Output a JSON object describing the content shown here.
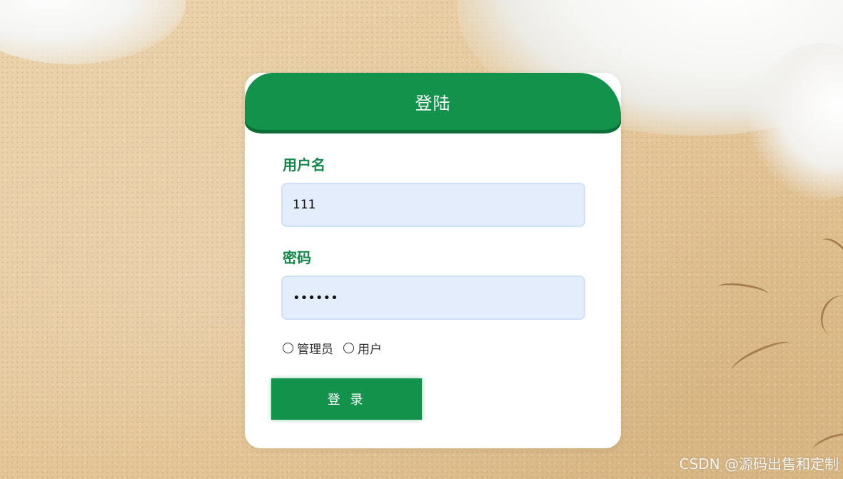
{
  "page": {
    "title": "登陆"
  },
  "form": {
    "username_label": "用户名",
    "username_value": "111",
    "password_label": "密码",
    "password_value": "••••••",
    "roles": [
      "管理员",
      "用户"
    ],
    "login_label": "登 录"
  },
  "watermark": "CSDN @源码出售和定制",
  "colors": {
    "primary": "#12924a",
    "input_bg": "#e4edfb",
    "label": "#13884a"
  }
}
